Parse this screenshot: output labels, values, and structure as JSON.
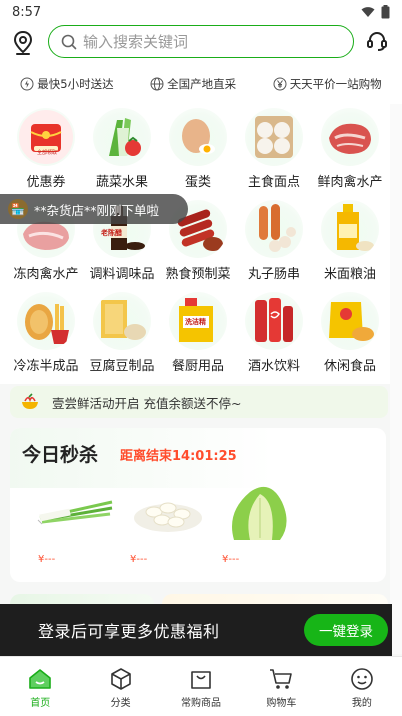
{
  "status": {
    "time": "8:57"
  },
  "header": {
    "search_placeholder": "输入搜索关键词"
  },
  "promises": [
    {
      "icon": "lightning-icon",
      "label": "最快5小时送达"
    },
    {
      "icon": "globe-icon",
      "label": "全国产地直采"
    },
    {
      "icon": "yen-icon",
      "label": "天天平价一站购物"
    }
  ],
  "categories": [
    {
      "label": "优惠券",
      "icon": "coupon-icon",
      "badge": "全部领取"
    },
    {
      "label": "蔬菜水果",
      "icon": "vegetable-icon"
    },
    {
      "label": "蛋类",
      "icon": "egg-icon"
    },
    {
      "label": "主食面点",
      "icon": "bun-icon"
    },
    {
      "label": "鲜肉禽水产",
      "icon": "meat-icon"
    },
    {
      "label": "冻肉禽水产",
      "icon": "frozen-meat-icon"
    },
    {
      "label": "调料调味品",
      "icon": "sauce-icon",
      "badge": "老陈醋"
    },
    {
      "label": "熟食预制菜",
      "icon": "sausage-icon"
    },
    {
      "label": "丸子肠串",
      "icon": "meatball-icon"
    },
    {
      "label": "米面粮油",
      "icon": "oil-icon"
    },
    {
      "label": "冷冻半成品",
      "icon": "fries-icon"
    },
    {
      "label": "豆腐豆制品",
      "icon": "tofu-icon"
    },
    {
      "label": "餐厨用品",
      "icon": "detergent-icon",
      "badge": "洗洁精"
    },
    {
      "label": "酒水饮料",
      "icon": "drink-icon"
    },
    {
      "label": "休闲食品",
      "icon": "snack-icon"
    }
  ],
  "toast": {
    "text": "**杂货店**刚刚下单啦"
  },
  "notice": {
    "text": "壹尝鲜活动开启 充值余额送不停~"
  },
  "flash": {
    "title": "今日秒杀",
    "countdown": "距离结束14:01:25",
    "items": [
      {
        "icon": "scallion-icon",
        "price": "¥---"
      },
      {
        "icon": "garlic-icon",
        "price": "¥---"
      },
      {
        "icon": "cabbage-icon",
        "price": "¥---"
      }
    ]
  },
  "login_banner": {
    "text": "登录后可享更多优惠福利",
    "button": "一键登录"
  },
  "tabs": [
    {
      "label": "首页",
      "icon": "home-icon",
      "active": true
    },
    {
      "label": "分类",
      "icon": "category-cube-icon"
    },
    {
      "label": "常购商品",
      "icon": "bag-icon"
    },
    {
      "label": "购物车",
      "icon": "cart-icon"
    },
    {
      "label": "我的",
      "icon": "smile-icon"
    }
  ],
  "colors": {
    "accent": "#1aad19",
    "price": "#ff4d2d"
  }
}
